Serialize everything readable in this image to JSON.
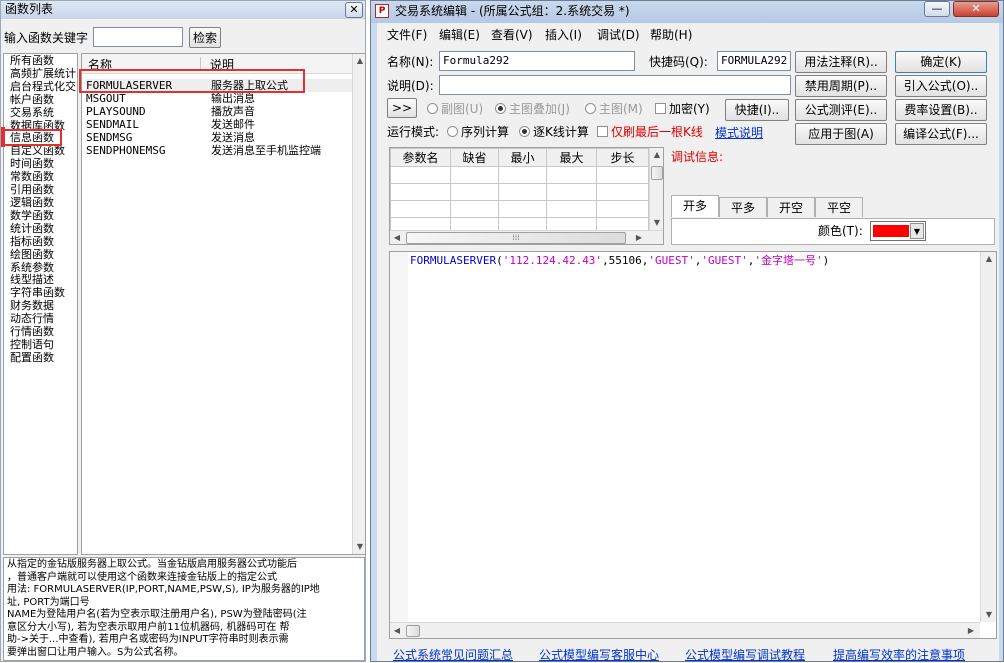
{
  "left_panel": {
    "title": "函数列表",
    "search_label": "输入函数关键字",
    "search_value": "",
    "search_button": "检索",
    "categories": [
      "所有函数",
      "高频扩展统计",
      "启台程式化交",
      "帐户函数",
      "交易系统",
      "数据库函数",
      "信息函数",
      "自定义函数",
      "时间函数",
      "常数函数",
      "引用函数",
      "逻辑函数",
      "数学函数",
      "统计函数",
      "指标函数",
      "绘图函数",
      "系统参数",
      "线型描述",
      "字符串函数",
      "财务数据",
      "动态行情",
      "行情函数",
      "控制语句",
      "配置函数"
    ],
    "col_name": "名称",
    "col_desc": "说明",
    "functions": [
      {
        "name": "FORMULASERVER",
        "desc": "服务器上取公式"
      },
      {
        "name": "MSGOUT",
        "desc": "输出消息"
      },
      {
        "name": "PLAYSOUND",
        "desc": "播放声音"
      },
      {
        "name": "SENDMAIL",
        "desc": "发送邮件"
      },
      {
        "name": "SENDMSG",
        "desc": "发送消息"
      },
      {
        "name": "SENDPHONEMSG",
        "desc": "发送消息至手机监控端"
      }
    ],
    "help_lines": [
      "从指定的金钻版服务器上取公式。当金钻版启用服务器公式功能后",
      "，普通客户端就可以使用这个函数来连接金钻版上的指定公式",
      "用法: FORMULASERVER(IP,PORT,NAME,PSW,S), IP为服务器的IP地",
      "址, PORT为端口号",
      "NAME为登陆用户名(若为空表示取注册用户名), PSW为登陆密码(注",
      "意区分大小写), 若为空表示取用户前11位机器码, 机器码可在 帮",
      "助->关于...中查看), 若用户名或密码为INPUT字符串时则表示需",
      "要弹出窗口让用户输入。S为公式名称。"
    ]
  },
  "editor": {
    "title": "交易系统编辑 - (所属公式组：2.系统交易 *)",
    "menu": [
      "文件(F)",
      "编辑(E)",
      "查看(V)",
      "插入(I)",
      "调试(D)",
      "帮助(H)"
    ],
    "name_label": "名称(N):",
    "name_value": "Formula292",
    "shortcut_label": "快捷码(Q):",
    "shortcut_value": "FORMULA292",
    "desc_label": "说明(D):",
    "desc_value": "",
    "right_buttons": [
      "用法注释(R)..",
      "禁用周期(P)..",
      "公式测评(E)..",
      "应用于图(A)"
    ],
    "right_buttons2": [
      "确定(K)",
      "引入公式(O)..",
      "费率设置(B)..",
      "编译公式(F)..."
    ],
    "expand_button": ">>",
    "radio_fig": "副图(U)",
    "radio_overlay": "主图叠加(J)",
    "radio_main": "主图(M)",
    "encrypt_label": "加密(Y)",
    "quick_button": "快捷(I)..",
    "run_mode_label": "运行模式:",
    "run_seq": "序列计算",
    "run_kline": "逐K线计算",
    "last_kline": "仅刷最后一根K线",
    "mode_link": "模式说明",
    "params_headers": [
      "参数名",
      "缺省",
      "最小",
      "最大",
      "步长"
    ],
    "debug_label": "调试信息:",
    "tabs": [
      "开多",
      "平多",
      "开空",
      "平空"
    ],
    "color_label": "颜色(T):",
    "color_value": "#ff0000",
    "code": {
      "fn": "FORMULASERVER",
      "open": "(",
      "ip": "'112.124.42.43'",
      "sep1": ",55106,",
      "u": "'GUEST'",
      "sep2": ",",
      "p": "'GUEST'",
      "sep3": ",",
      "s": "'金字塔一号'",
      "close": ")"
    },
    "footer_links": [
      "公式系统常见问题汇总",
      "公式模型编写客服中心",
      "公式模型编写调试教程",
      "提高编写效率的注意事项"
    ]
  }
}
